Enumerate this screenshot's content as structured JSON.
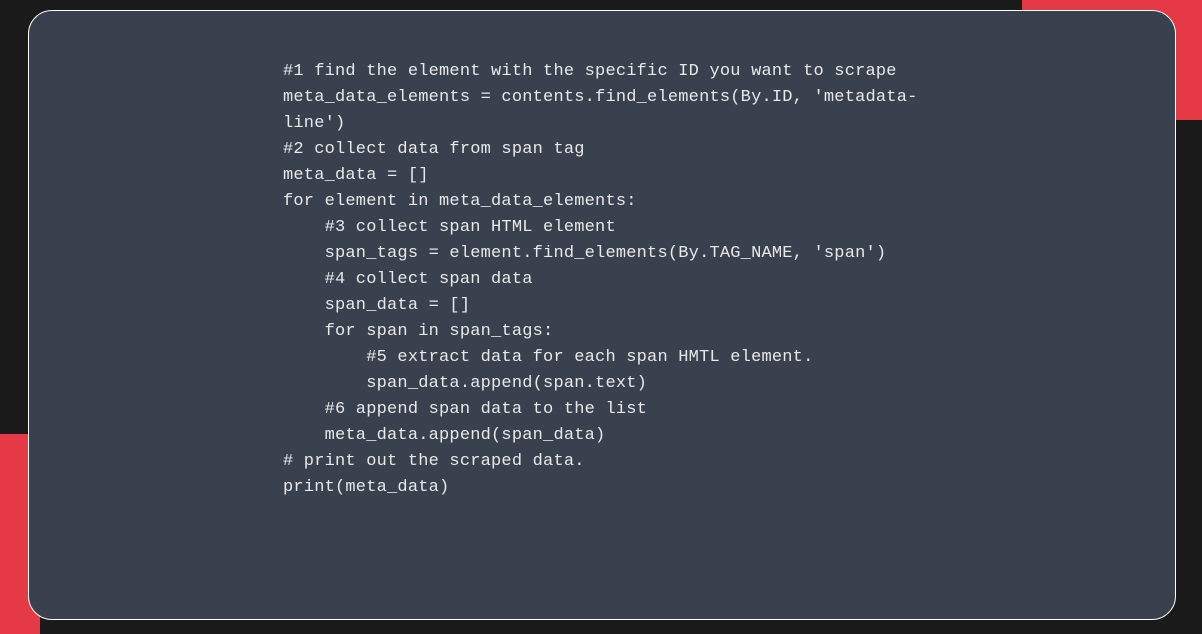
{
  "code": {
    "line1": "#1 find the element with the specific ID you want to scrape",
    "line2": "meta_data_elements = contents.find_elements(By.ID, 'metadata-",
    "line3": "line')",
    "line4": "",
    "line5": "#2 collect data from span tag",
    "line6": "meta_data = []",
    "line7": "",
    "line8": "for element in meta_data_elements:",
    "line9": "    #3 collect span HTML element",
    "line10": "    span_tags = element.find_elements(By.TAG_NAME, 'span')",
    "line11": "",
    "line12": "    #4 collect span data",
    "line13": "    span_data = []",
    "line14": "    for span in span_tags:",
    "line15": "        #5 extract data for each span HMTL element.",
    "line16": "        span_data.append(span.text)",
    "line17": "    #6 append span data to the list",
    "line18": "    meta_data.append(span_data)",
    "line19": "",
    "line20": "# print out the scraped data.",
    "line21": "print(meta_data)"
  }
}
